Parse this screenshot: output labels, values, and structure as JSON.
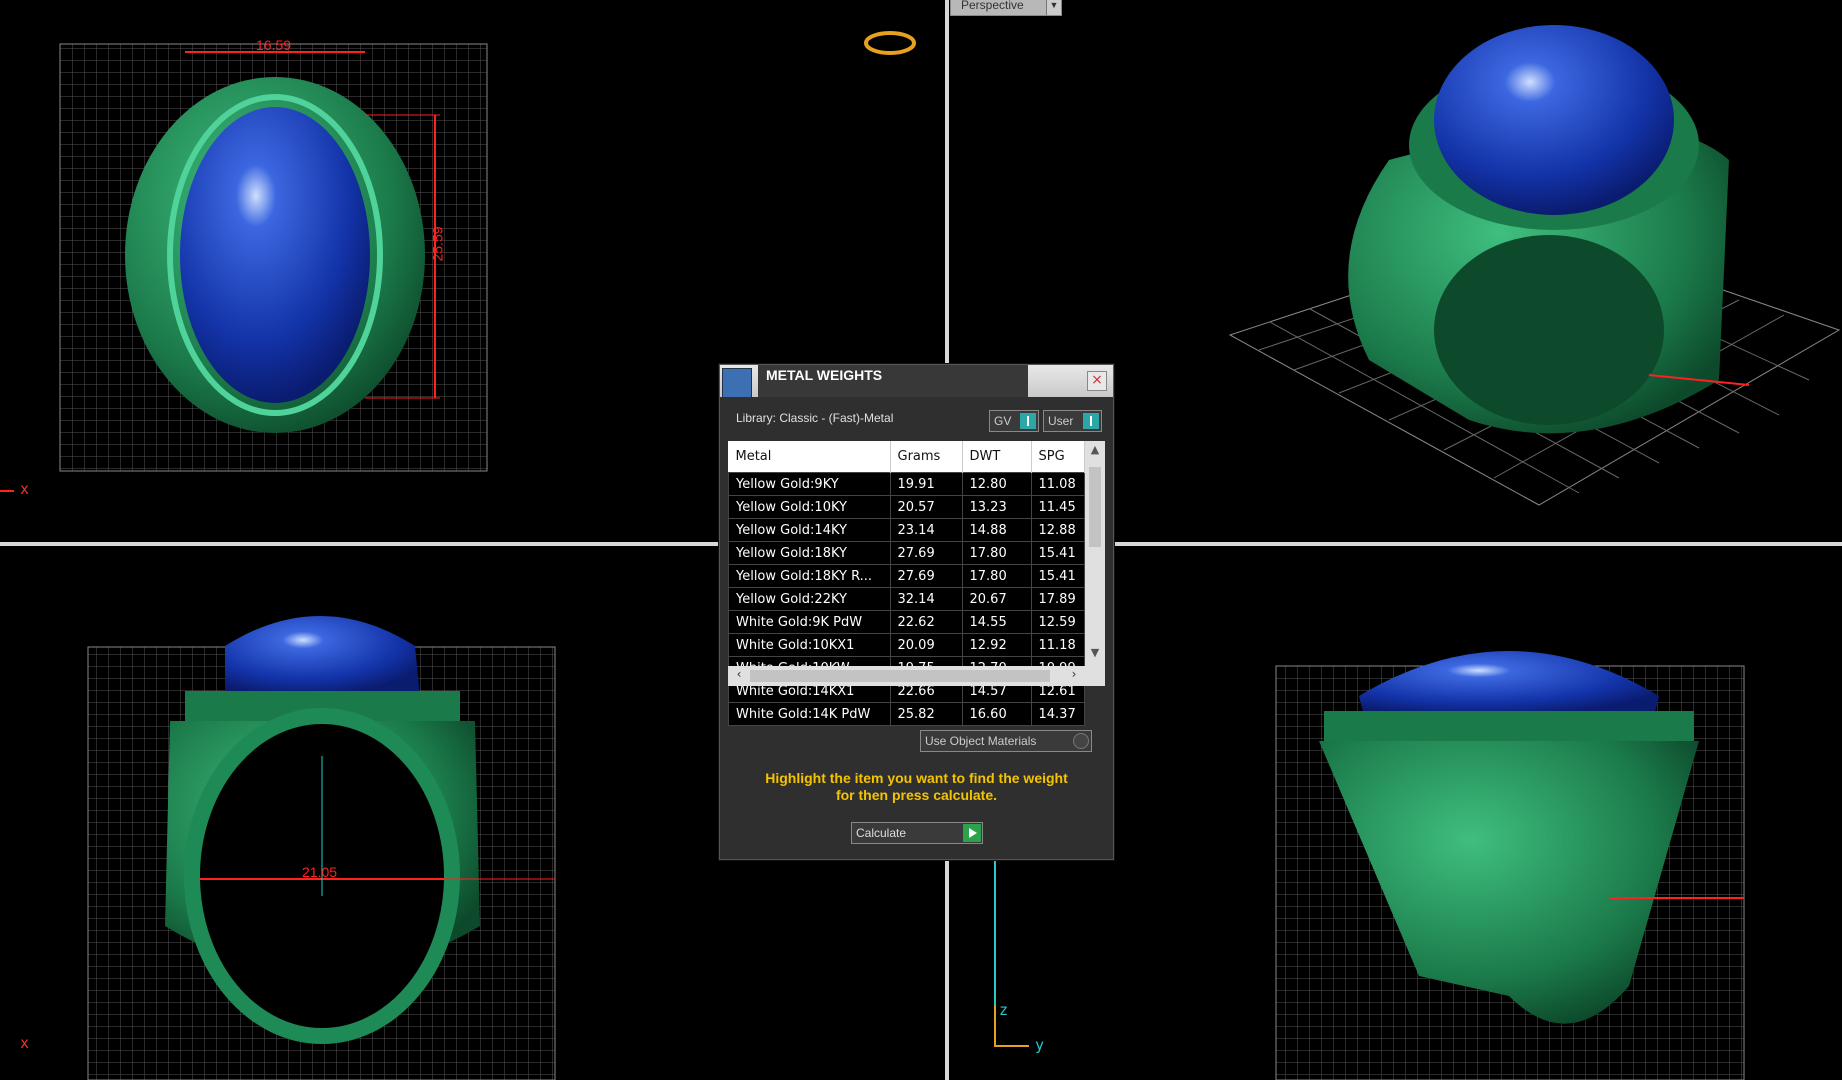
{
  "viewports": {
    "perspective_tab": "Perspective",
    "top_view": {
      "dim_width": "16.59",
      "dim_height": "25.59",
      "axis_x": "x"
    },
    "front_view": {
      "dim_inner": "21.05",
      "axis_x": "x"
    },
    "side_view": {
      "axis_z": "z",
      "axis_y": "y"
    }
  },
  "dialog": {
    "title": "METAL WEIGHTS",
    "close_label": "×",
    "library": "Library: Classic - (Fast)-Metal",
    "toggle_gv": "GV",
    "toggle_user": "User",
    "columns": [
      "Metal",
      "Grams",
      "DWT",
      "SPG"
    ],
    "rows": [
      [
        "Yellow Gold:9KY",
        "19.91",
        "12.80",
        "11.08"
      ],
      [
        "Yellow Gold:10KY",
        "20.57",
        "13.23",
        "11.45"
      ],
      [
        "Yellow Gold:14KY",
        "23.14",
        "14.88",
        "12.88"
      ],
      [
        "Yellow Gold:18KY",
        "27.69",
        "17.80",
        "15.41"
      ],
      [
        "Yellow Gold:18KY R...",
        "27.69",
        "17.80",
        "15.41"
      ],
      [
        "Yellow Gold:22KY",
        "32.14",
        "20.67",
        "17.89"
      ],
      [
        "White Gold:9K PdW",
        "22.62",
        "14.55",
        "12.59"
      ],
      [
        "White Gold:10KX1",
        "20.09",
        "12.92",
        "11.18"
      ],
      [
        "White Gold:10KW",
        "19.75",
        "12.70",
        "10.99"
      ],
      [
        "White Gold:14KX1",
        "22.66",
        "14.57",
        "12.61"
      ],
      [
        "White Gold:14K PdW",
        "25.82",
        "16.60",
        "14.37"
      ]
    ],
    "use_object_materials": "Use Object Materials",
    "hint_line1": "Highlight the item you want to find the weight",
    "hint_line2": "for then press calculate.",
    "calculate": "Calculate"
  },
  "colors": {
    "ring": "#1e8a55",
    "stone": "#1a3fc0",
    "dimension": "#ff2020",
    "hint": "#f5c400"
  }
}
